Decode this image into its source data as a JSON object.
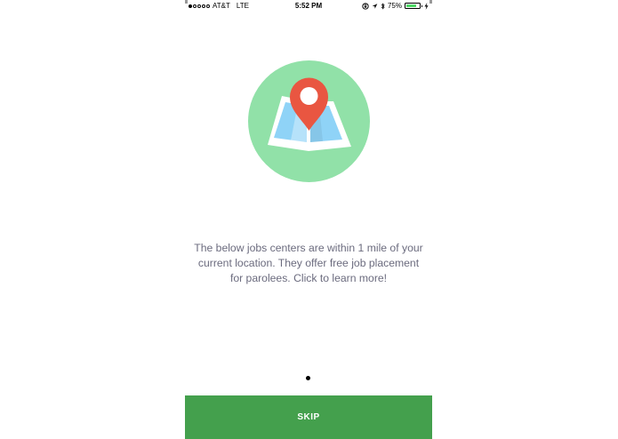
{
  "status_bar": {
    "signal_bars_filled": 1,
    "signal_bars_total": 5,
    "carrier": "AT&T",
    "network": "LTE",
    "time": "5:52 PM",
    "battery_percent": "75%",
    "battery_level": 0.75,
    "icons": [
      "orientation-lock-icon",
      "location-arrow-icon",
      "bluetooth-icon",
      "battery-icon",
      "charging-bolt-icon"
    ]
  },
  "main": {
    "illustration_icon": "map-location-pin-icon",
    "message": "The below jobs centers are within 1 mile of your current location. They offer free job placement for parolees. Click to learn more!",
    "page_indicator": {
      "total": 1,
      "current": 1
    }
  },
  "footer": {
    "skip_label": "SKIP"
  },
  "colors": {
    "circle": "#91e1a8",
    "pin": "#e95641",
    "map": "#8fd3f7",
    "skip_button": "#44a04d",
    "message_text": "#6b6b7e"
  }
}
